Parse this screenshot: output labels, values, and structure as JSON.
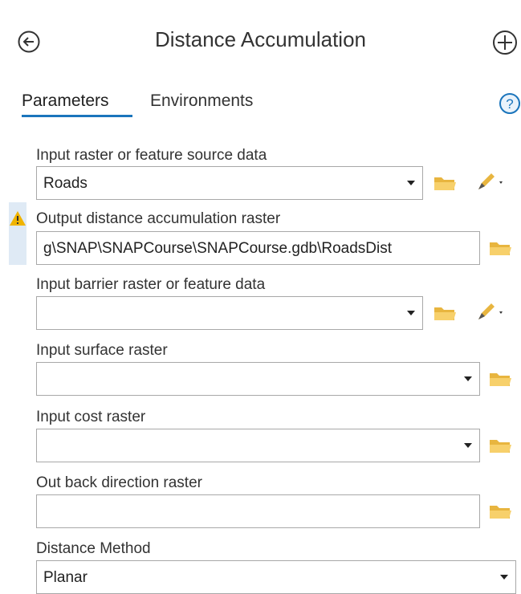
{
  "header": {
    "title": "Distance Accumulation",
    "back_icon": "back-arrow-circle-icon",
    "add_icon": "plus-circle-icon"
  },
  "tabs": [
    {
      "label": "Parameters",
      "active": true
    },
    {
      "label": "Environments",
      "active": false
    }
  ],
  "help_icon": "help-question-icon",
  "params": {
    "input_source": {
      "label": "Input raster or feature source data",
      "value": "Roads"
    },
    "output_raster": {
      "label": "Output distance accumulation raster",
      "value": "g\\SNAP\\SNAPCourse\\SNAPCourse.gdb\\RoadsDist",
      "warning": true
    },
    "barrier": {
      "label": "Input barrier raster or feature data",
      "value": ""
    },
    "surface": {
      "label": "Input surface raster",
      "value": ""
    },
    "cost": {
      "label": "Input cost raster",
      "value": ""
    },
    "back_direction": {
      "label": "Out back direction raster",
      "value": ""
    },
    "distance_method": {
      "label": "Distance Method",
      "value": "Planar"
    }
  },
  "colors": {
    "accent": "#1b75bc",
    "folder": "#f2c14e",
    "warning": "#f0b400"
  }
}
